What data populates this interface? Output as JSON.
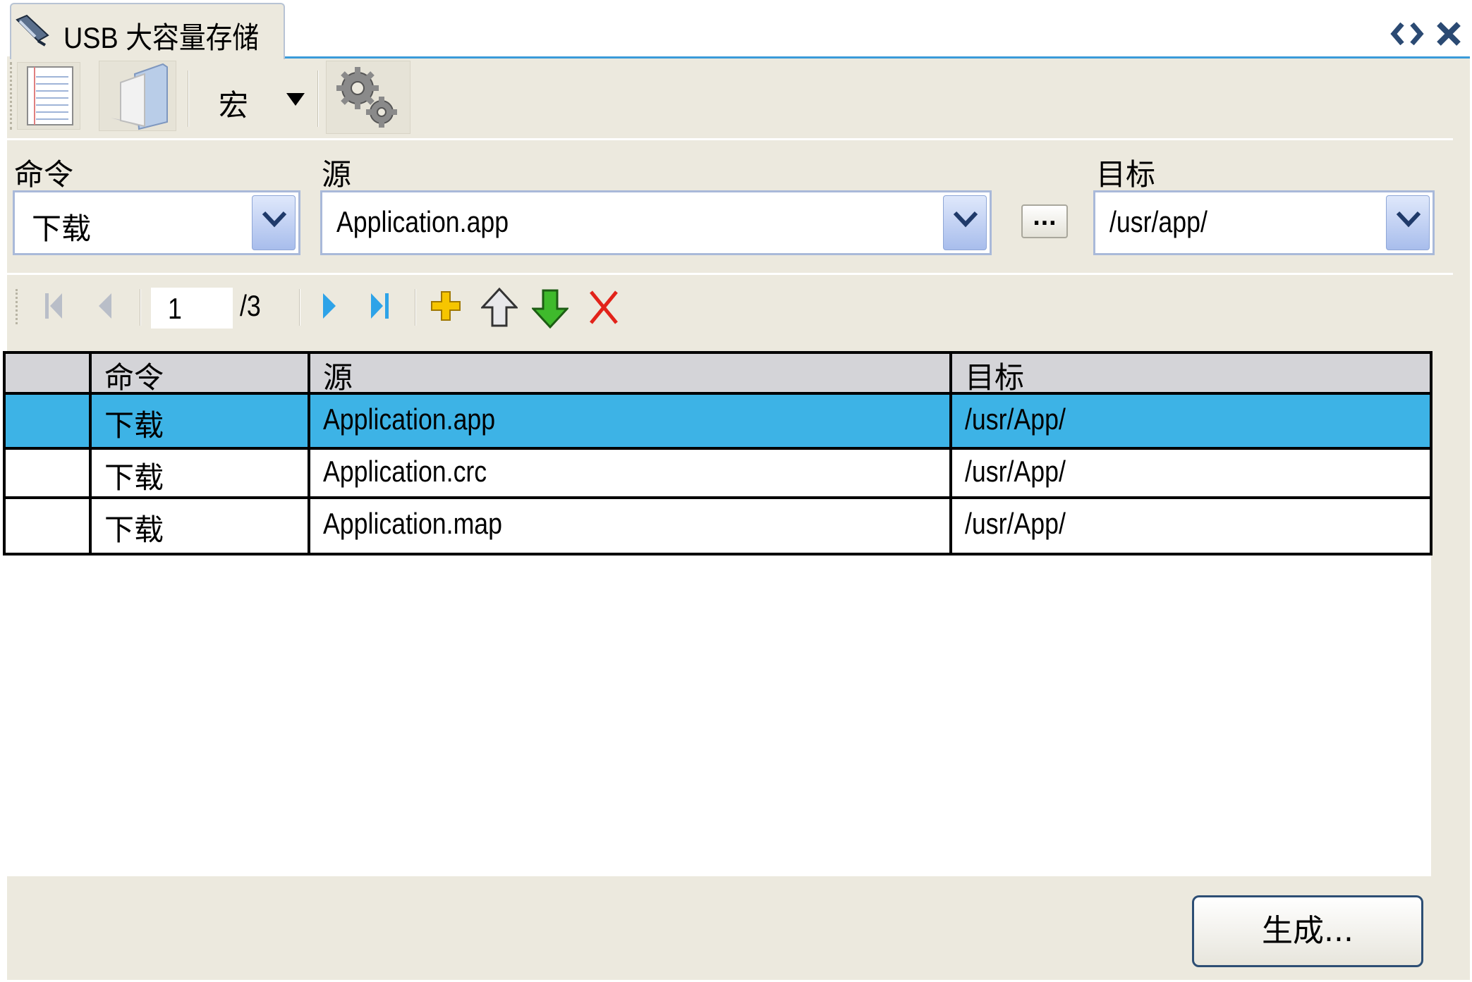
{
  "window": {
    "title": "USB 大容量存储",
    "collapse_icon": "collapse-arrows-icon",
    "close_icon": "close-icon"
  },
  "toolbar": {
    "list_icon": "document-list-icon",
    "folder_icon": "folder-icon",
    "macro_label": "宏",
    "settings_icon": "gears-icon"
  },
  "fields": {
    "command_label": "命令",
    "command_value": "下载",
    "source_label": "源",
    "source_value": "Application.app",
    "browse_label": "...",
    "target_label": "目标",
    "target_value": "/usr/app/"
  },
  "pager": {
    "current_page": "1",
    "total_pages": "/3",
    "icons": [
      "first-page-icon",
      "previous-page-icon",
      "next-page-icon",
      "last-page-icon",
      "add-icon",
      "move-up-icon",
      "move-down-icon",
      "delete-icon"
    ]
  },
  "table": {
    "headers": [
      "命令",
      "源",
      "目标"
    ],
    "rows": [
      {
        "command": "下载",
        "source": "Application.app",
        "target": "/usr/App/",
        "selected": true
      },
      {
        "command": "下载",
        "source": "Application.crc",
        "target": "/usr/App/",
        "selected": false
      },
      {
        "command": "下载",
        "source": "Application.map",
        "target": "/usr/App/",
        "selected": false
      }
    ]
  },
  "footer": {
    "generate_label": "生成..."
  },
  "colors": {
    "panel_bg": "#ece9de",
    "selection": "#3db3e6",
    "header_bg": "#d4d4d8",
    "tab_accent": "#3a9bd9"
  }
}
